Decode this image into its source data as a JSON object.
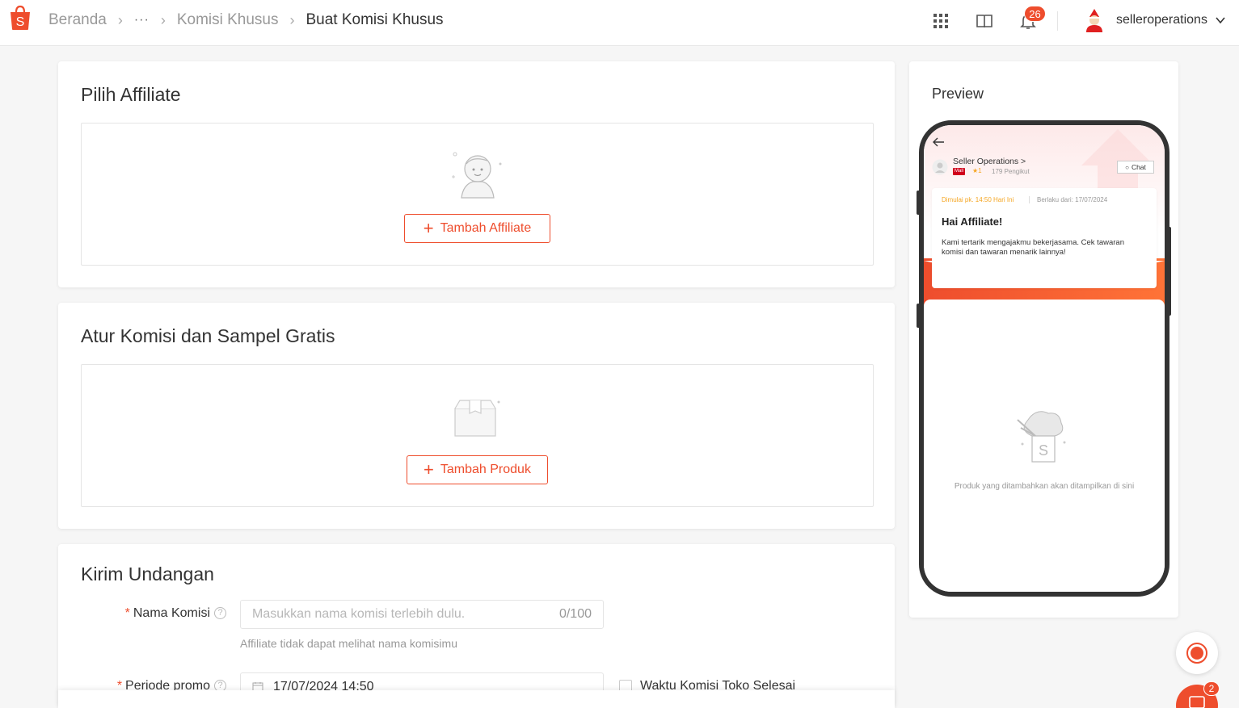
{
  "breadcrumb": {
    "home": "Beranda",
    "ellipsis": "···",
    "level2": "Komisi Khusus",
    "current": "Buat Komisi Khusus"
  },
  "header": {
    "notification_count": "26",
    "username": "selleroperations",
    "icons": [
      "shopee-logo",
      "apps-grid-icon",
      "book-icon",
      "bell-icon",
      "chevron-down-icon"
    ]
  },
  "affiliate_section": {
    "title": "Pilih Affiliate",
    "add_button": "Tambah Affiliate"
  },
  "commission_section": {
    "title": "Atur Komisi dan Sampel Gratis",
    "add_button": "Tambah Produk"
  },
  "invite_section": {
    "title": "Kirim Undangan",
    "name_label": "Nama Komisi",
    "name_placeholder": "Masukkan nama komisi terlebih dulu.",
    "name_count": "0/100",
    "name_hint": "Affiliate tidak dapat melihat nama komisimu",
    "period_label": "Periode promo",
    "period_value": "17/07/2024 14:50",
    "end_checkbox_label": "Waktu Komisi Toko Selesai",
    "required_mark": "*",
    "help_mark": "?"
  },
  "preview": {
    "title": "Preview",
    "shop_name": "Seller Operations >",
    "shop_badge": "Mall",
    "rating": "★1",
    "followers": "179 Pengikut",
    "chat_button": "Chat",
    "start_time": "Dimulai pk. 14:50 Hari Ini",
    "valid_from": "Berlaku dari: 17/07/2024",
    "greeting": "Hai Affiliate!",
    "message": "Kami tertarik mengajakmu bekerjasama. Cek tawaran komisi dan tawaran menarik lainnya!",
    "empty_products": "Produk yang ditambahkan akan ditampilkan di sini"
  },
  "floating": {
    "chat_badge": "2"
  },
  "colors": {
    "brand": "#ee4d2d",
    "accent_text": "#f5a623"
  }
}
